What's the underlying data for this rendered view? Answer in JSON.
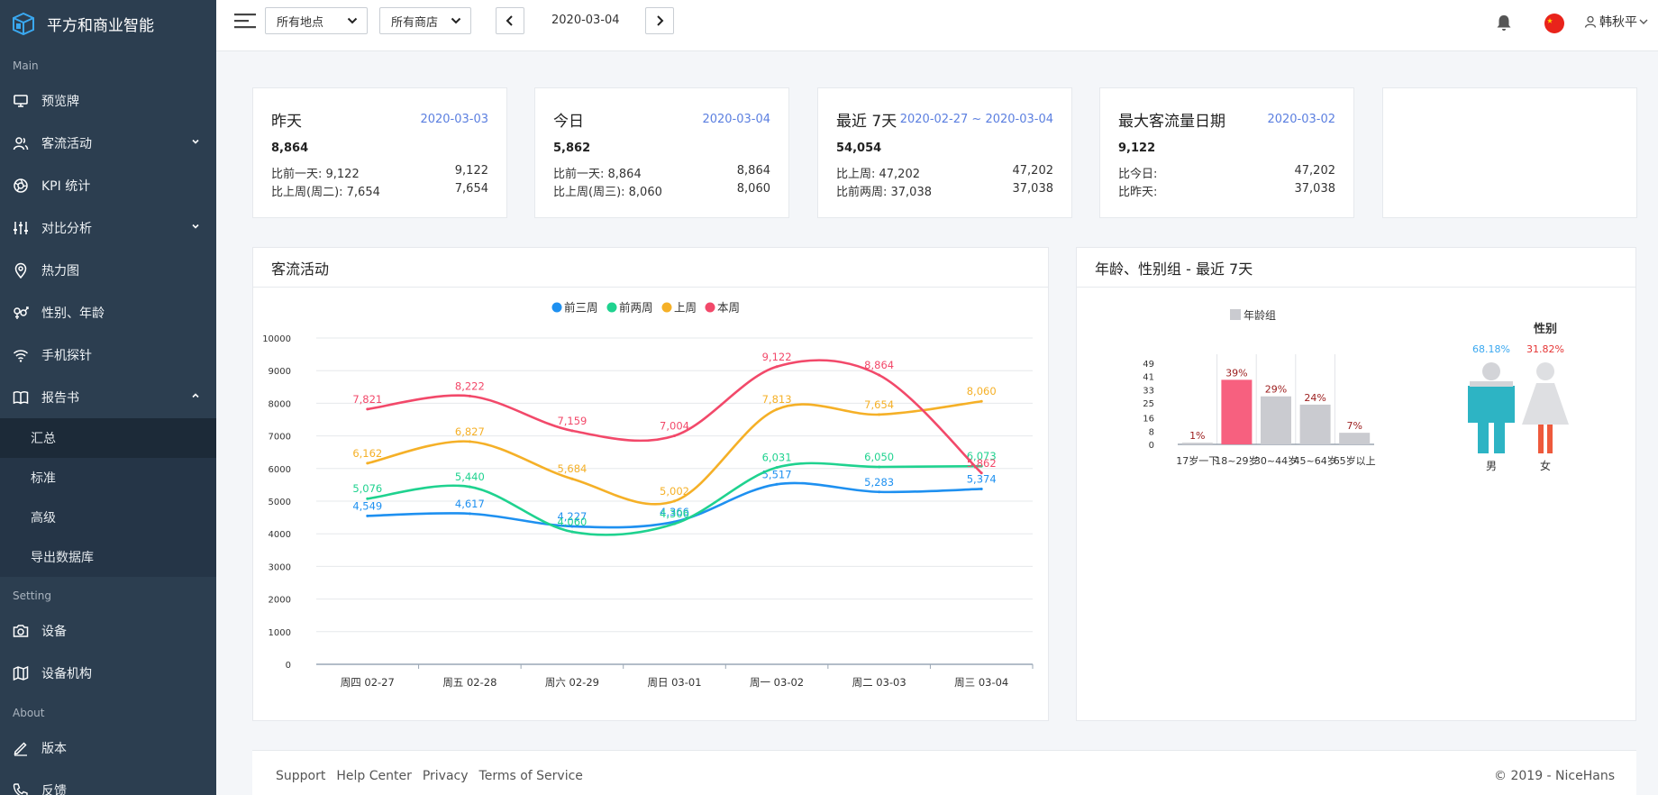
{
  "app": {
    "name": "平方和商业智能"
  },
  "sidebar": {
    "sections": {
      "main": "Main",
      "setting": "Setting",
      "about": "About"
    },
    "items": {
      "preview": "预览牌",
      "traffic": "客流活动",
      "kpi": "KPI 统计",
      "compare": "对比分析",
      "heatmap": "热力图",
      "gender_age": "性别、年龄",
      "phone": "手机探针",
      "report": "报告书",
      "device": "设备",
      "device_org": "设备机构",
      "version": "版本",
      "feedback": "反馈"
    },
    "report_sub": {
      "summary": "汇总",
      "standard": "标准",
      "advanced": "高级",
      "export": "导出数据库"
    }
  },
  "topbar": {
    "location_select": "所有地点",
    "store_select": "所有商店",
    "date": "2020-03-04",
    "user": "韩秋平"
  },
  "stats": [
    {
      "title": "昨天",
      "range": "2020-03-03",
      "value": "8,864",
      "rows": [
        {
          "label": "比前一天: 9,122",
          "value": "9,122"
        },
        {
          "label": "比上周(周二): 7,654",
          "value": "7,654"
        }
      ]
    },
    {
      "title": "今日",
      "range": "2020-03-04",
      "value": "5,862",
      "rows": [
        {
          "label": "比前一天: 8,864",
          "value": "8,864"
        },
        {
          "label": "比上周(周三): 8,060",
          "value": "8,060"
        }
      ]
    },
    {
      "title": "最近 7天",
      "range": "2020-02-27 ~ 2020-03-04",
      "value": "54,054",
      "rows": [
        {
          "label": "比上周: 47,202",
          "value": "47,202"
        },
        {
          "label": "比前两周: 37,038",
          "value": "37,038"
        }
      ]
    },
    {
      "title": "最大客流量日期",
      "range": "2020-03-02",
      "value": "9,122",
      "rows": [
        {
          "label": "比今日:",
          "value": "47,202"
        },
        {
          "label": "比昨天:",
          "value": "37,038"
        }
      ]
    }
  ],
  "traffic_panel": {
    "title": "客流活动"
  },
  "demo_panel": {
    "title": "年龄、性别组 - 最近 7天"
  },
  "footer": {
    "links": [
      "Support",
      "Help Center",
      "Privacy",
      "Terms of Service"
    ],
    "copyright": "© 2019 - NiceHans"
  },
  "chart_data": [
    {
      "type": "line",
      "categories": [
        "周四 02-27",
        "周五 02-28",
        "周六 02-29",
        "周日 03-01",
        "周一 03-02",
        "周二 03-03",
        "周三 03-04"
      ],
      "ylim": [
        0,
        10000
      ],
      "yticks": [
        0,
        1000,
        2000,
        3000,
        4000,
        5000,
        6000,
        7000,
        8000,
        9000,
        10000
      ],
      "legend_position": "top-center",
      "grid": true,
      "series": [
        {
          "name": "前三周",
          "color": "#1e90f0",
          "values": [
            4549,
            4617,
            4227,
            4366,
            5517,
            5283,
            5374
          ]
        },
        {
          "name": "前两周",
          "color": "#1fd28f",
          "values": [
            5076,
            5440,
            4060,
            4306,
            6031,
            6050,
            6073
          ]
        },
        {
          "name": "上周",
          "color": "#f5b027",
          "values": [
            6162,
            6827,
            5684,
            5002,
            7813,
            7654,
            8060
          ]
        },
        {
          "name": "本周",
          "color": "#f2496a",
          "values": [
            7821,
            8222,
            7159,
            7004,
            9122,
            8864,
            5862
          ]
        }
      ]
    },
    {
      "type": "bar",
      "legend": "年龄组",
      "categories": [
        "17岁一下",
        "18~29岁",
        "30~44岁",
        "45~64岁",
        "65岁以上"
      ],
      "values": [
        1,
        39,
        29,
        24,
        7
      ],
      "value_labels": [
        "1%",
        "39%",
        "29%",
        "24%",
        "7%"
      ],
      "highlight_index": 1,
      "highlight_color": "#f7607f",
      "bar_color": "#cacbd0",
      "yticks": [
        0,
        8,
        16,
        25,
        33,
        41,
        49
      ],
      "ylim": [
        0,
        49
      ]
    },
    {
      "type": "pie",
      "title": "性别",
      "categories": [
        "男",
        "女"
      ],
      "values": [
        68.18,
        31.82
      ],
      "value_labels": [
        "68.18%",
        "31.82%"
      ],
      "colors": [
        "#2db4c4",
        "#ee5a3c"
      ]
    }
  ]
}
